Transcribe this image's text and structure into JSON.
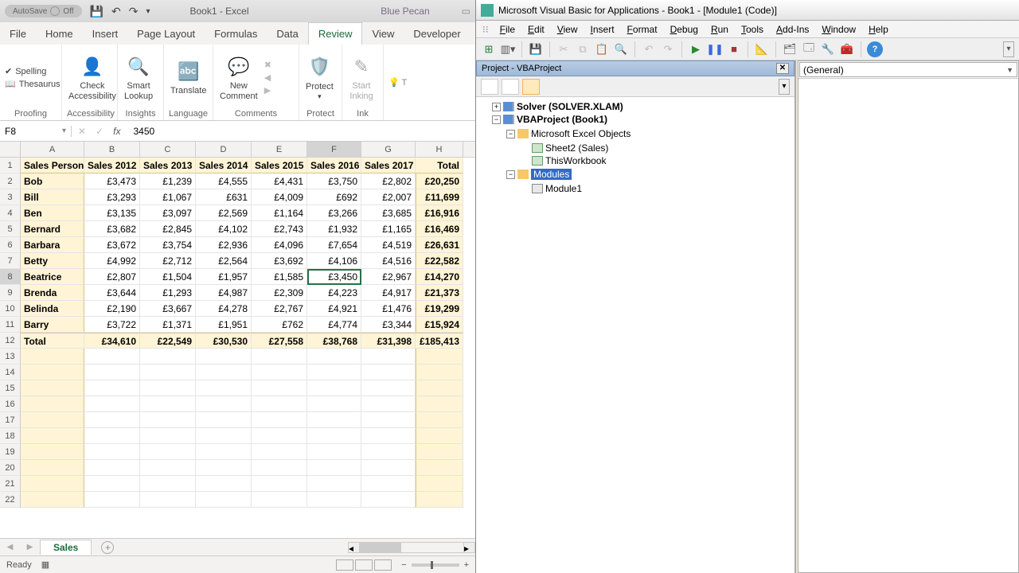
{
  "excel": {
    "title": {
      "autosave": "AutoSave",
      "autosave_state": "Off",
      "book": "Book1 - Excel",
      "user": "Blue Pecan"
    },
    "ribbon_tabs": [
      "File",
      "Home",
      "Insert",
      "Page Layout",
      "Formulas",
      "Data",
      "Review",
      "View",
      "Developer"
    ],
    "ribbon_active": 6,
    "ribbon": {
      "proofing": {
        "label": "Proofing",
        "spelling": "Spelling",
        "thesaurus": "Thesaurus"
      },
      "accessibility": {
        "label": "Accessibility",
        "btn": "Check\nAccessibility"
      },
      "insights": {
        "label": "Insights",
        "btn": "Smart\nLookup"
      },
      "language": {
        "label": "Language",
        "btn": "Translate"
      },
      "comments": {
        "label": "Comments",
        "new": "New\nComment"
      },
      "protect": {
        "label": "Protect",
        "btn": "Protect"
      },
      "ink": {
        "label": "Ink",
        "btn": "Start\nInking"
      }
    },
    "namebox": "F8",
    "formula": "3450",
    "columns": [
      "A",
      "B",
      "C",
      "D",
      "E",
      "F",
      "G",
      "H"
    ],
    "selected_col": 5,
    "selected_row": 8,
    "headers": [
      "Sales Person",
      "Sales 2012",
      "Sales 2013",
      "Sales 2014",
      "Sales 2015",
      "Sales 2016",
      "Sales 2017",
      "Total"
    ],
    "data": [
      [
        "Bob",
        "£3,473",
        "£1,239",
        "£4,555",
        "£4,431",
        "£3,750",
        "£2,802",
        "£20,250"
      ],
      [
        "Bill",
        "£3,293",
        "£1,067",
        "£631",
        "£4,009",
        "£692",
        "£2,007",
        "£11,699"
      ],
      [
        "Ben",
        "£3,135",
        "£3,097",
        "£2,569",
        "£1,164",
        "£3,266",
        "£3,685",
        "£16,916"
      ],
      [
        "Bernard",
        "£3,682",
        "£2,845",
        "£4,102",
        "£2,743",
        "£1,932",
        "£1,165",
        "£16,469"
      ],
      [
        "Barbara",
        "£3,672",
        "£3,754",
        "£2,936",
        "£4,096",
        "£7,654",
        "£4,519",
        "£26,631"
      ],
      [
        "Betty",
        "£4,992",
        "£2,712",
        "£2,564",
        "£3,692",
        "£4,106",
        "£4,516",
        "£22,582"
      ],
      [
        "Beatrice",
        "£2,807",
        "£1,504",
        "£1,957",
        "£1,585",
        "£3,450",
        "£2,967",
        "£14,270"
      ],
      [
        "Brenda",
        "£3,644",
        "£1,293",
        "£4,987",
        "£2,309",
        "£4,223",
        "£4,917",
        "£21,373"
      ],
      [
        "Belinda",
        "£2,190",
        "£3,667",
        "£4,278",
        "£2,767",
        "£4,921",
        "£1,476",
        "£19,299"
      ],
      [
        "Barry",
        "£3,722",
        "£1,371",
        "£1,951",
        "£762",
        "£4,774",
        "£3,344",
        "£15,924"
      ]
    ],
    "totals": [
      "Total",
      "£34,610",
      "£22,549",
      "£30,530",
      "£27,558",
      "£38,768",
      "£31,398",
      "£185,413"
    ],
    "empty_rows": [
      13,
      14,
      15,
      16,
      17,
      18,
      19,
      20,
      21,
      22
    ],
    "sheet_tab": "Sales",
    "status": "Ready"
  },
  "vbe": {
    "title": "Microsoft Visual Basic for Applications - Book1 - [Module1 (Code)]",
    "menus": [
      "File",
      "Edit",
      "View",
      "Insert",
      "Format",
      "Debug",
      "Run",
      "Tools",
      "Add-Ins",
      "Window",
      "Help"
    ],
    "project_title": "Project - VBAProject",
    "tree": {
      "solver": "Solver (SOLVER.XLAM)",
      "vbaproj": "VBAProject (Book1)",
      "mso": "Microsoft Excel Objects",
      "sheet": "Sheet2 (Sales)",
      "twb": "ThisWorkbook",
      "modules": "Modules",
      "mod1": "Module1"
    },
    "code_combo": "(General)"
  }
}
